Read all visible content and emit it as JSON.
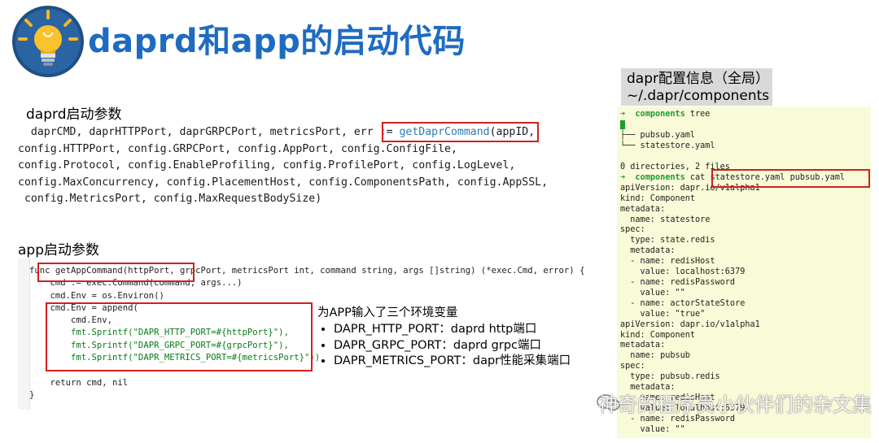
{
  "title": "daprd和app的启动代码",
  "daprd_section": {
    "heading": "daprd启动参数",
    "lines": [
      {
        "pre": "  daprCMD, daprHTTPPort, daprGRPCPort, metricsPort, err ",
        "assign": ":= ",
        "fn": "getDaprCommand",
        "post": "(appID,"
      },
      {
        "text": "config.HTTPPort, config.GRPCPort, config.AppPort, config.ConfigFile,"
      },
      {
        "text": "config.Protocol, config.EnableProfiling, config.ProfilePort, config.LogLevel,"
      },
      {
        "text": "config.MaxConcurrency, config.PlacementHost, config.ComponentsPath, config.AppSSL,"
      },
      {
        "text": " config.MetricsPort, config.MaxRequestBodySize)"
      }
    ]
  },
  "app_section": {
    "heading": "app启动参数",
    "code": [
      "func getAppCommand(httpPort, grpcPort, metricsPort int, command string, args []string) (*exec.Cmd, error) {",
      "    cmd := exec.Command(command, args...)",
      "    cmd.Env = os.Environ()",
      "    cmd.Env = append(",
      "        cmd.Env,",
      "        fmt.Sprintf(\"DAPR_HTTP_PORT=#{httpPort}\"),",
      "        fmt.Sprintf(\"DAPR_GRPC_PORT=#{grpcPort}\"),",
      "        fmt.Sprintf(\"DAPR_METRICS_PORT=#{metricsPort}\"))",
      "",
      "    return cmd, nil",
      "}"
    ],
    "env_heading": "为APP输入了三个环境变量",
    "env_items": [
      "DAPR_HTTP_PORT：daprd http端口",
      "DAPR_GRPC_PORT：daprd grpc端口",
      "DAPR_METRICS_PORT：dapr性能采集端口"
    ]
  },
  "config_section": {
    "title_line1": "dapr配置信息（全局）",
    "title_line2": "~/.dapr/components",
    "terminal": {
      "prompt_dir": "components",
      "cmd1": "tree",
      "tree_dot": ".",
      "tree_items": [
        "pubsub.yaml",
        "statestore.yaml"
      ],
      "summary": "0 directories, 2 files",
      "cmd2": "cat statestore.yaml pubsub.yaml",
      "yaml": [
        "apiVersion: dapr.io/v1alpha1",
        "kind: Component",
        "metadata:",
        "  name: statestore",
        "spec:",
        "  type: state.redis",
        "  metadata:",
        "  - name: redisHost",
        "    value: localhost:6379",
        "  - name: redisPassword",
        "    value: \"\"",
        "  - name: actorStateStore",
        "    value: \"true\"",
        "apiVersion: dapr.io/v1alpha1",
        "kind: Component",
        "metadata:",
        "  name: pubsub",
        "spec:",
        "  type: pubsub.redis",
        "  metadata:",
        "  - name: redisHost",
        "    value: localhost:6379",
        "  - name: redisPassword",
        "    value: \"\""
      ]
    }
  },
  "watermark": "神奇的程序员小伙伴们的杂文集",
  "colors": {
    "title": "#1f6bc1",
    "highlight_box": "#d2201c",
    "terminal_bg": "#f9fad8",
    "terminal_green": "#1a9b30"
  },
  "icons": {
    "logo": "lightbulb-icon",
    "watermark": "wechat-icon"
  }
}
